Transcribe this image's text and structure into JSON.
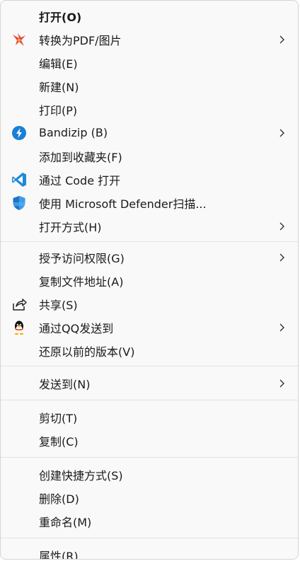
{
  "menu": {
    "open": "打开(O)",
    "convert_pdf": "转换为PDF/图片",
    "edit": "编辑(E)",
    "new": "新建(N)",
    "print": "打印(P)",
    "bandizip": "Bandizip (B)",
    "add_to_favorites": "添加到收藏夹(F)",
    "open_with_code": "通过 Code 打开",
    "defender_scan": "使用 Microsoft Defender扫描...",
    "open_with": "打开方式(H)",
    "grant_access": "授予访问权限(G)",
    "copy_path": "复制文件地址(A)",
    "share": "共享(S)",
    "send_via_qq": "通过QQ发送到",
    "restore_versions": "还原以前的版本(V)",
    "send_to": "发送到(N)",
    "cut": "剪切(T)",
    "copy": "复制(C)",
    "create_shortcut": "创建快捷方式(S)",
    "delete": "删除(D)",
    "rename": "重命名(M)",
    "properties": "属性(R)"
  },
  "icons": {
    "convert_pdf": "pdf-bird-icon",
    "bandizip": "bandizip-icon",
    "vscode": "vscode-icon",
    "defender": "defender-shield-icon",
    "share": "share-icon",
    "qq": "qq-penguin-icon",
    "submenu": "chevron-right-icon"
  },
  "colors": {
    "menu_bg": "#f9f9f9",
    "text": "#1a1a1a",
    "separator": "#e3e3e3",
    "bandizip_blue": "#1a7fd6",
    "vscode_blue": "#1e8ad6",
    "defender_blue": "#1e73c8",
    "pdf_red": "#e8473a"
  }
}
